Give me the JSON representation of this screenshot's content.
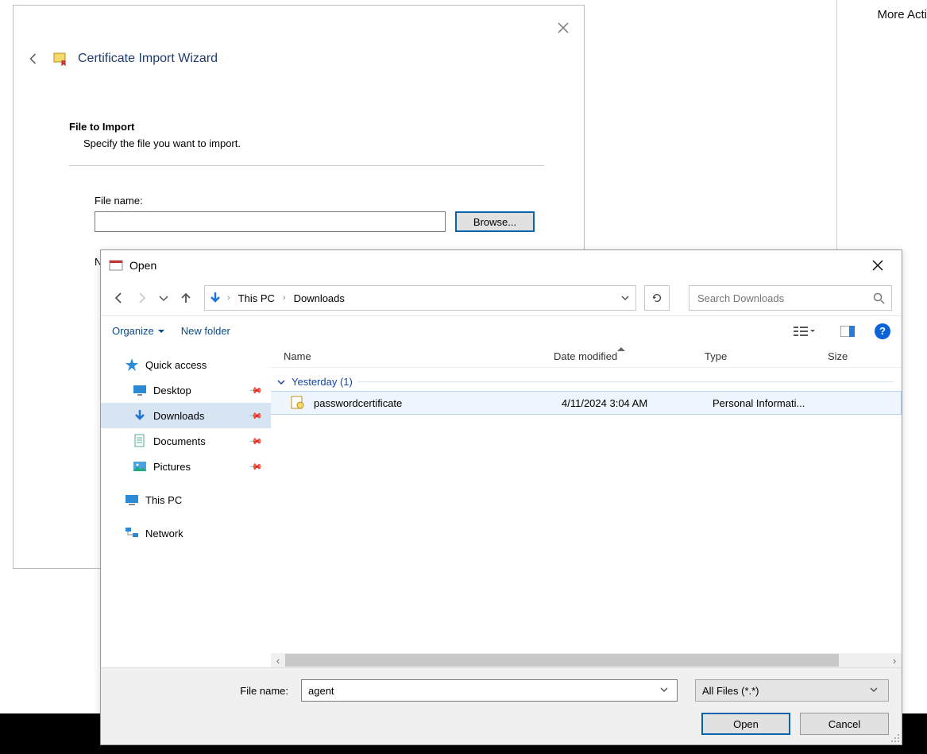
{
  "actions_pane": {
    "more_actions": "More Acti"
  },
  "wizard": {
    "title": "Certificate Import Wizard",
    "section_title": "File to Import",
    "section_subtitle": "Specify the file you want to import.",
    "filename_label": "File name:",
    "filename_value": "",
    "browse_label": "Browse...",
    "note_prefix": "No"
  },
  "filedlg": {
    "title": "Open",
    "breadcrumb": {
      "root_chevron": "›",
      "pc": "This PC",
      "folder": "Downloads"
    },
    "search_placeholder": "Search Downloads",
    "toolbar": {
      "organize": "Organize",
      "new_folder": "New folder"
    },
    "columns": {
      "name": "Name",
      "date": "Date modified",
      "type": "Type",
      "size": "Size"
    },
    "nav": {
      "quick_access": "Quick access",
      "desktop": "Desktop",
      "downloads": "Downloads",
      "documents": "Documents",
      "pictures": "Pictures",
      "this_pc": "This PC",
      "network": "Network"
    },
    "group": {
      "label": "Yesterday (1)"
    },
    "files": [
      {
        "name": "passwordcertificate",
        "date": "4/11/2024 3:04 AM",
        "type": "Personal Informati..."
      }
    ],
    "footer": {
      "filename_label": "File name:",
      "filename_value": "agent",
      "filter": "All Files (*.*)",
      "open": "Open",
      "cancel": "Cancel"
    }
  }
}
